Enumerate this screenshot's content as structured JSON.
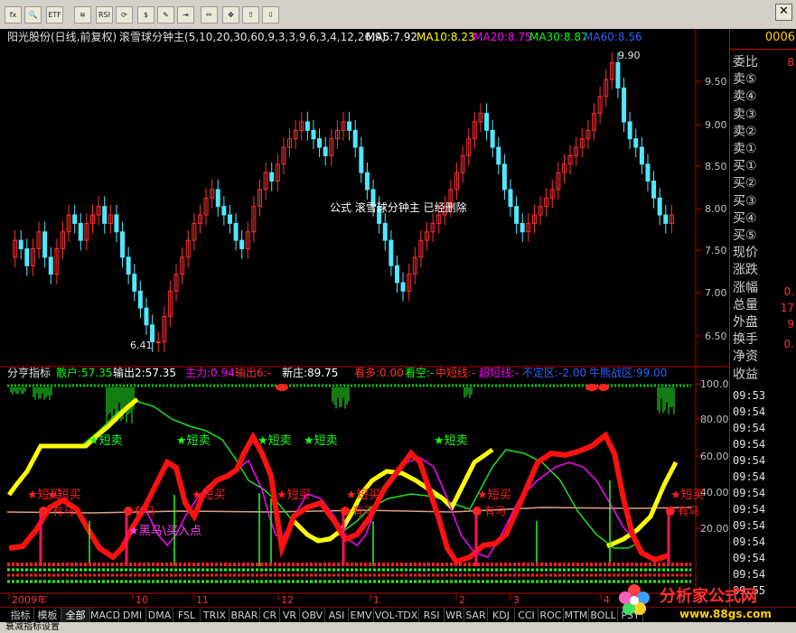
{
  "toolbar": {
    "buttons": [
      {
        "name": "fx-formula-button",
        "label": "fx"
      },
      {
        "name": "zoom-button",
        "label": "🔍"
      },
      {
        "name": "etf-button",
        "label": "ETF"
      },
      {
        "name": "kline-button",
        "label": "≋"
      },
      {
        "name": "rsi-button",
        "label": "RSI"
      },
      {
        "name": "refresh-button",
        "label": "⟳"
      },
      {
        "name": "dollar-button",
        "label": "$"
      },
      {
        "name": "tools-button",
        "label": "✎"
      },
      {
        "name": "export-button",
        "label": "⇥"
      },
      {
        "name": "pen-button",
        "label": "✏"
      },
      {
        "name": "move-button",
        "label": "✥"
      },
      {
        "name": "up-arrow-button",
        "label": "⇧"
      },
      {
        "name": "down-arrow-button",
        "label": "⇩"
      }
    ],
    "close_label": "✕"
  },
  "main_chart": {
    "title": "阳光股份(日线,前复权)",
    "indicator_text": "滚雪球分钟主(5,10,20,30,60,9,3,3,9,6,3,4,12,26,9)",
    "ma5": "MA5:7.92",
    "ma10": "MA10:8.23",
    "ma20": "MA20:8.75",
    "ma30": "MA30:8.87",
    "ma60": "MA60:8.56",
    "notice": "公式 滚雪球分钟主 已经删除",
    "high_label": "9.90",
    "low_label": "6.41",
    "price_ticks": [
      "9.50",
      "9.00",
      "8.50",
      "8.00",
      "7.50",
      "7.00",
      "6.50"
    ],
    "colors": {
      "ma5": "#ffffff",
      "ma10": "#ffff00",
      "ma20": "#ff00ff",
      "ma30": "#00ff00",
      "ma60": "#3060ff",
      "up": "#ff3030",
      "down": "#50e8ff"
    }
  },
  "sub_chart": {
    "name": "分亨指标",
    "sanhu": "散户:57.35",
    "shuchu": "输出2:57.35",
    "zhuli": "主力:0.94",
    "shuchu6": "输出6:-",
    "xinzhuang": "新庄:89.75",
    "kanduo": "看多:0.00",
    "kankong": "看空:-",
    "zhongduan": "中短线:-",
    "chaoduan": "超短线:-",
    "budingqu": "不定区:-2.00",
    "niuneng": "牛熊战区:99.00",
    "ticks": [
      "100.0",
      "80.00",
      "60.00",
      "40.00",
      "20.00"
    ],
    "annotations": {
      "duanmai_sell": "★短卖",
      "duanmai_buy": "★短买",
      "youma": "有马",
      "heima": "★黑马\\买入点",
      "qishou": "★短买"
    }
  },
  "time_axis": {
    "labels": [
      "2009年",
      "10",
      "11",
      "12",
      "1",
      "2",
      "3",
      "4"
    ]
  },
  "right_panel": {
    "code": "0006",
    "labels": [
      "委比",
      "卖⑤",
      "卖④",
      "卖③",
      "卖②",
      "卖①",
      "买①",
      "买②",
      "买③",
      "买④",
      "买⑤",
      "现价",
      "涨跌",
      "涨幅",
      "总量",
      "外盘",
      "换手",
      "净资",
      "收益"
    ],
    "values": {
      "weibi": "8",
      "zhangfu": "0.",
      "zongliang": "17",
      "waipan": "9",
      "huanshou": "0."
    },
    "times": [
      "09:53",
      "09:54",
      "09:54",
      "09:54",
      "09:54",
      "09:54",
      "09:54",
      "09:54",
      "09:54",
      "09:54",
      "09:54",
      "09:54",
      "09:55"
    ]
  },
  "bottom_tabs": [
    "指标",
    "模板",
    "全部",
    "MACD",
    "DMI",
    "DMA",
    "FSL",
    "TRIX",
    "BRAR",
    "CR",
    "VR",
    "OBV",
    "ASI",
    "EMV",
    "VOL-TDX",
    "RSI",
    "WR",
    "SAR",
    "KDJ",
    "CCI",
    "ROC",
    "MTM",
    "BOLL",
    "PSY"
  ],
  "status": "衰减指标设置",
  "watermark": {
    "title": "分析家公式网",
    "url": "www.88gs.com"
  }
}
